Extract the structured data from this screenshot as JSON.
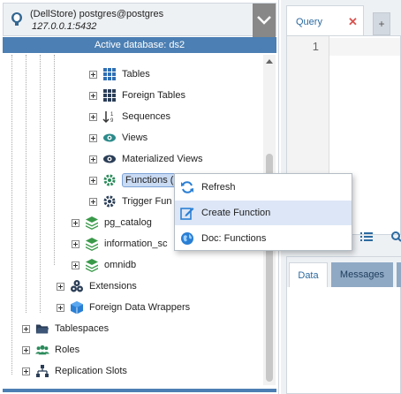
{
  "connection": {
    "title": "(DellStore) postgres@postgres",
    "host": "127.0.0.1:5432"
  },
  "active_database": "Active database: ds2",
  "tree": {
    "items": [
      {
        "label": "Tables",
        "icon": "table-icon"
      },
      {
        "label": "Foreign Tables",
        "icon": "foreign-table-icon"
      },
      {
        "label": "Sequences",
        "icon": "sequence-icon"
      },
      {
        "label": "Views",
        "icon": "view-icon"
      },
      {
        "label": "Materialized Views",
        "icon": "materialized-view-icon"
      },
      {
        "label": "Functions (",
        "icon": "function-icon"
      },
      {
        "label": "Trigger Fun",
        "icon": "trigger-function-icon"
      },
      {
        "label": "pg_catalog",
        "icon": "schema-icon"
      },
      {
        "label": "information_sc",
        "icon": "schema-icon"
      },
      {
        "label": "omnidb",
        "icon": "schema-icon"
      },
      {
        "label": "Extensions",
        "icon": "extension-icon"
      },
      {
        "label": "Foreign Data Wrappers",
        "icon": "fdw-icon"
      },
      {
        "label": "Tablespaces",
        "icon": "folder-icon"
      },
      {
        "label": "Roles",
        "icon": "roles-icon"
      },
      {
        "label": "Replication Slots",
        "icon": "replication-icon"
      }
    ]
  },
  "query_tab": {
    "label": "Query",
    "close": "✕",
    "add": "+"
  },
  "editor": {
    "line_number": "1"
  },
  "results_tabs": {
    "data": "Data",
    "messages": "Messages"
  },
  "context_menu": {
    "items": [
      {
        "label": "Refresh",
        "icon": "refresh-icon"
      },
      {
        "label": "Create Function",
        "icon": "edit-icon"
      },
      {
        "label": "Doc: Functions",
        "icon": "globe-icon"
      }
    ]
  },
  "colors": {
    "accent": "#4c7fb3",
    "schema_green": "#3a9a4a",
    "menu_highlight": "#dce6f6"
  }
}
